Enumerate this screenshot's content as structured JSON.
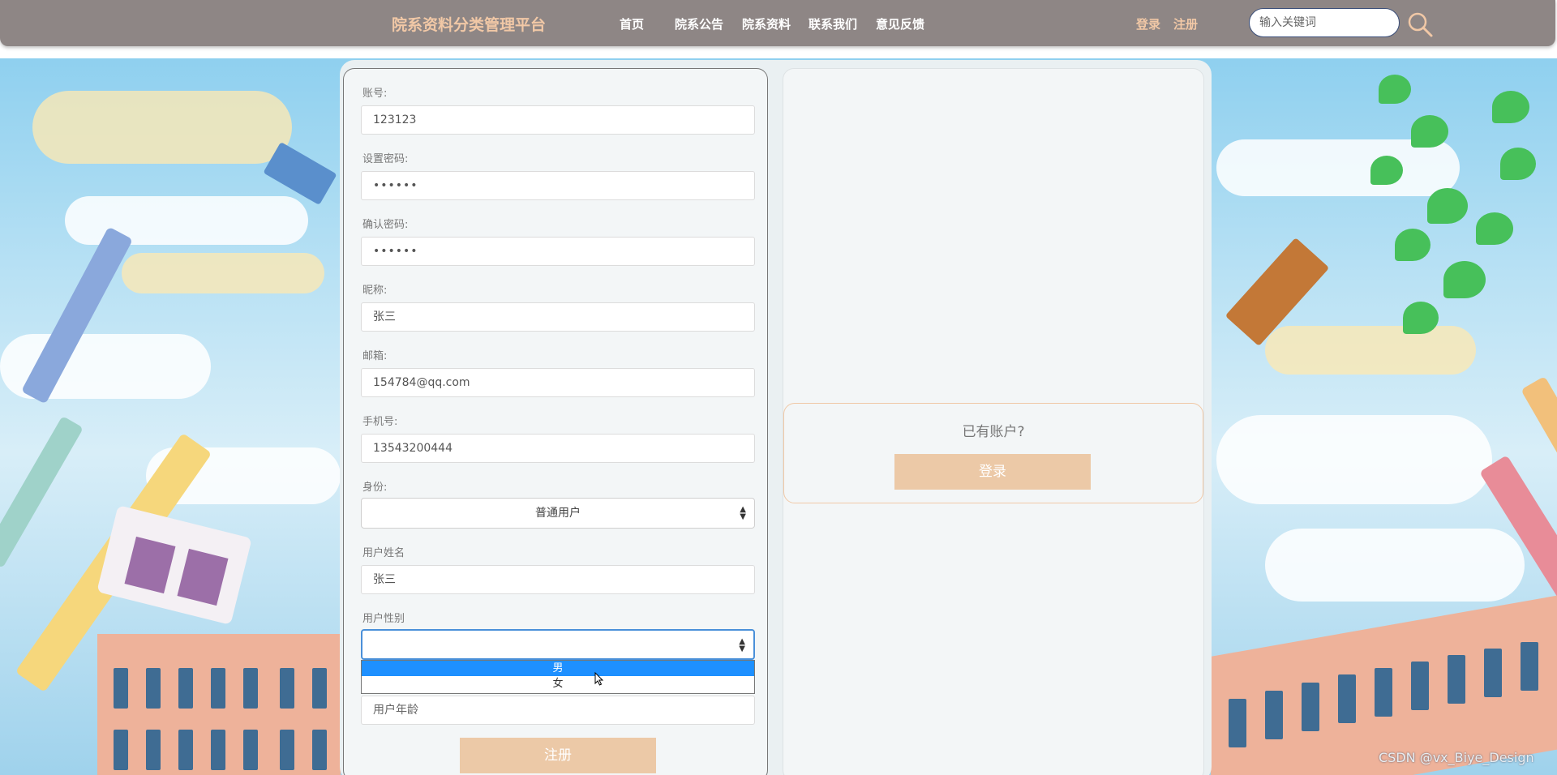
{
  "header": {
    "brand": "院系资料分类管理平台",
    "nav": [
      "首页",
      "院系公告",
      "院系资料",
      "联系我们",
      "意见反馈"
    ],
    "login": "登录",
    "register": "注册",
    "search_placeholder": "输入关键词"
  },
  "form": {
    "account_label": "账号:",
    "account_value": "123123",
    "password_label": "设置密码:",
    "password_value": "••••••",
    "confirm_label": "确认密码:",
    "confirm_value": "••••••",
    "nickname_label": "昵称:",
    "nickname_value": "张三",
    "email_label": "邮箱:",
    "email_value": "154784@qq.com",
    "phone_label": "手机号:",
    "phone_value": "13543200444",
    "role_label": "身份:",
    "role_value": "普通用户",
    "username_label": "用户姓名",
    "username_value": "张三",
    "gender_label": "用户性别",
    "gender_value": "",
    "gender_options": [
      "男",
      "女"
    ],
    "gender_highlighted": "男",
    "age_placeholder": "用户年龄",
    "register_button": "注册"
  },
  "side": {
    "have_account": "已有账户?",
    "login_button": "登录"
  },
  "watermark": "CSDN @vx_Biye_Design",
  "colors": {
    "nav_bg": "#8e8685",
    "brand": "#f1c8a6",
    "button": "#ecc9a7",
    "highlight": "#1e90ff"
  }
}
